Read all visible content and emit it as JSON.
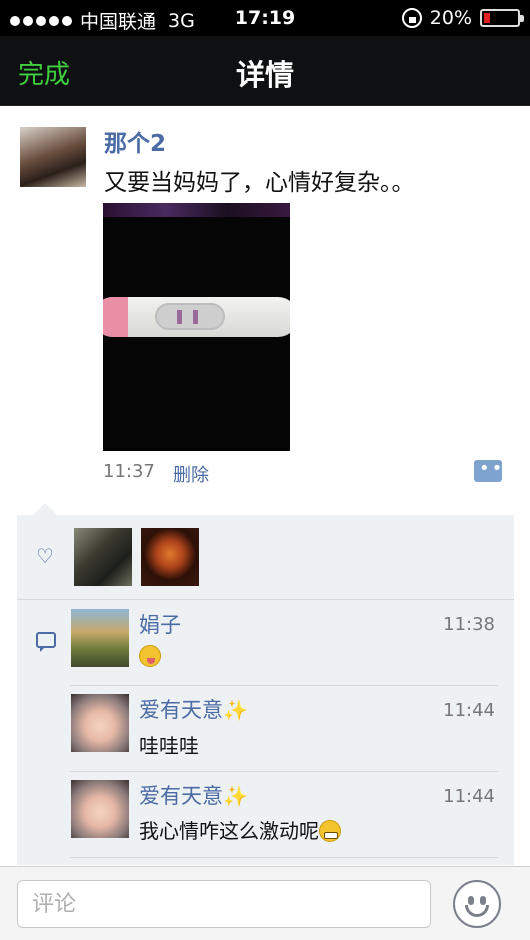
{
  "status_bar": {
    "carrier": "中国联通",
    "network": "3G",
    "time": "17:19",
    "battery_percent_label": "20%",
    "battery_level": 0.2
  },
  "nav": {
    "done_label": "完成",
    "title": "详情"
  },
  "post": {
    "author": "那个2",
    "text": "又要当妈妈了，心情好复杂。。",
    "time": "11:37",
    "delete_label": "删除"
  },
  "comments": [
    {
      "name": "娟子",
      "time": "11:38",
      "text": ""
    },
    {
      "name": "爱有天意",
      "time": "11:44",
      "text": "哇哇哇"
    },
    {
      "name": "爱有天意",
      "time": "11:44",
      "text": "我心情咋这么激动呢"
    }
  ],
  "input": {
    "placeholder": "评论"
  },
  "colors": {
    "link": "#4a6ba3",
    "done": "#3fcf3f",
    "panel": "#eef1f4"
  }
}
